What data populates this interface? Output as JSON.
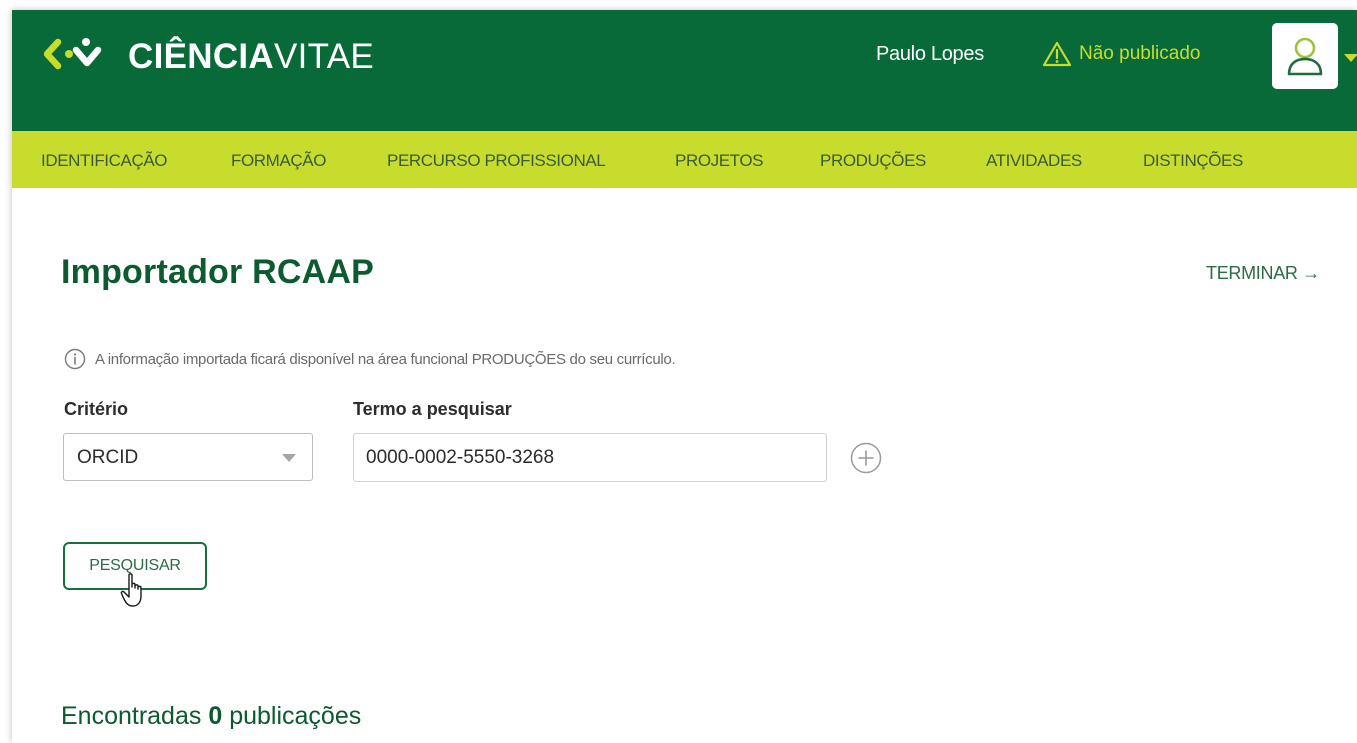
{
  "header": {
    "logo_bold": "CIÊNCIA",
    "logo_light": "VITAE",
    "user_name": "Paulo Lopes",
    "publication_status": "Não publicado"
  },
  "nav": {
    "items": [
      "IDENTIFICAÇÃO",
      "FORMAÇÃO",
      "PERCURSO PROFISSIONAL",
      "PROJETOS",
      "PRODUÇÕES",
      "ATIVIDADES",
      "DISTINÇÕES"
    ]
  },
  "main": {
    "title": "Importador RCAAP",
    "finish_label": "TERMINAR →",
    "info_text": "A informação importada ficará disponível na área funcional PRODUÇÕES do seu currículo.",
    "criterion_label": "Critério",
    "criterion_value": "ORCID",
    "term_label": "Termo a pesquisar",
    "term_value": "0000-0002-5550-3268",
    "search_button": "PESQUISAR",
    "results_prefix": "Encontradas",
    "results_count": "0",
    "results_suffix": "publicações"
  },
  "colors": {
    "header_green": "#076a38",
    "nav_lime": "#c8dc2e",
    "title_green": "#0c5a2f",
    "button_border": "#1a6e3d"
  },
  "icons": [
    "logo-mark-icon",
    "warning-icon",
    "user-icon",
    "info-icon",
    "plus-circle-icon",
    "hand-cursor-icon"
  ]
}
